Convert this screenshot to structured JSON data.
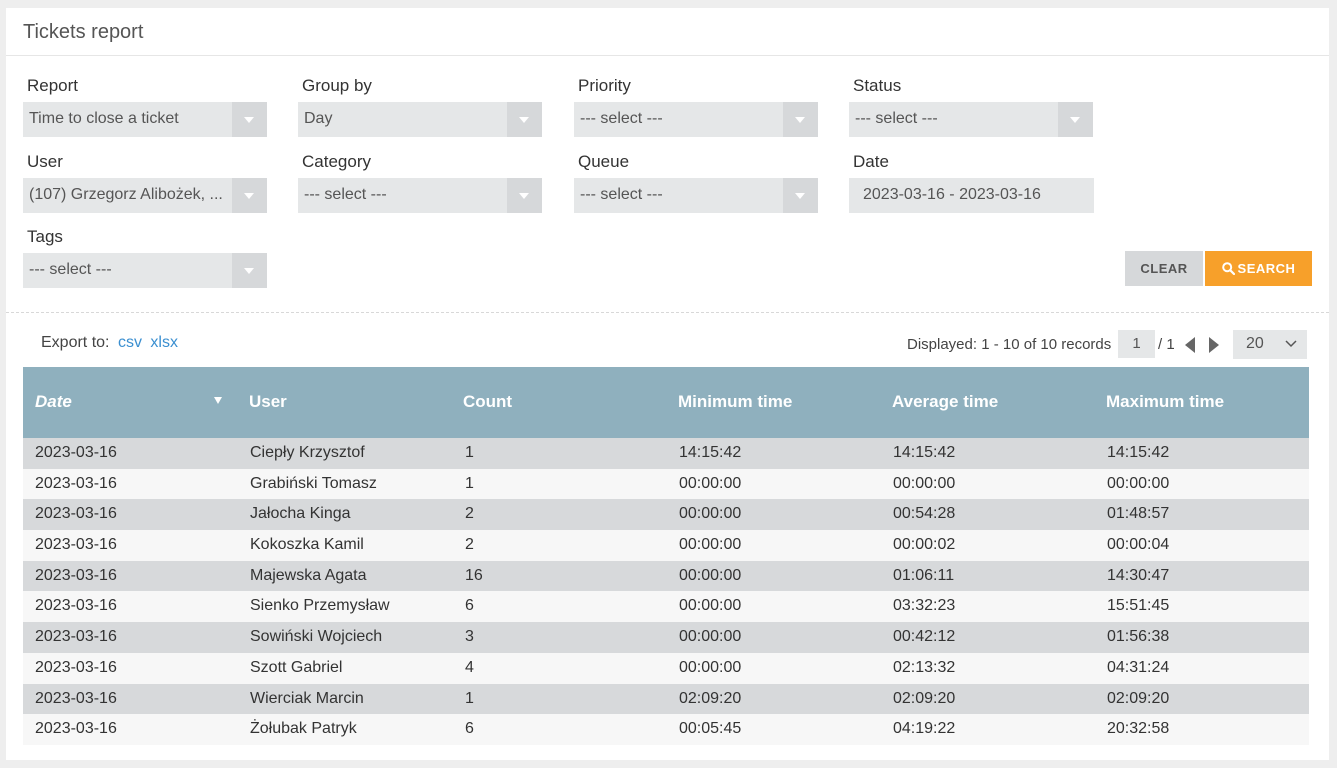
{
  "panel": {
    "title": "Tickets report"
  },
  "filters": {
    "report": {
      "label": "Report",
      "value": "Time to close a ticket"
    },
    "group_by": {
      "label": "Group by",
      "value": "Day"
    },
    "priority": {
      "label": "Priority",
      "value": "--- select ---"
    },
    "status": {
      "label": "Status",
      "value": "--- select ---"
    },
    "user": {
      "label": "User",
      "value": "(107) Grzegorz Alibożek, ..."
    },
    "category": {
      "label": "Category",
      "value": "--- select ---"
    },
    "queue": {
      "label": "Queue",
      "value": "--- select ---"
    },
    "date": {
      "label": "Date",
      "value": "2023-03-16 - 2023-03-16"
    },
    "tags": {
      "label": "Tags",
      "value": "--- select ---"
    }
  },
  "buttons": {
    "clear": "CLEAR",
    "search": "SEARCH"
  },
  "export": {
    "label": "Export to:",
    "csv": "csv",
    "xlsx": "xlsx"
  },
  "pager": {
    "displayed": "Displayed: 1 - 10 of 10 records",
    "current_page": "1",
    "total_pages": "/ 1",
    "per_page": "20"
  },
  "table": {
    "columns": [
      "Date",
      "User",
      "Count",
      "Minimum time",
      "Average time",
      "Maximum time"
    ],
    "rows": [
      [
        "2023-03-16",
        "Ciepły Krzysztof",
        "1",
        "14:15:42",
        "14:15:42",
        "14:15:42"
      ],
      [
        "2023-03-16",
        "Grabiński Tomasz",
        "1",
        "00:00:00",
        "00:00:00",
        "00:00:00"
      ],
      [
        "2023-03-16",
        "Jałocha Kinga",
        "2",
        "00:00:00",
        "00:54:28",
        "01:48:57"
      ],
      [
        "2023-03-16",
        "Kokoszka Kamil",
        "2",
        "00:00:00",
        "00:00:02",
        "00:00:04"
      ],
      [
        "2023-03-16",
        "Majewska Agata",
        "16",
        "00:00:00",
        "01:06:11",
        "14:30:47"
      ],
      [
        "2023-03-16",
        "Sienko Przemysław",
        "6",
        "00:00:00",
        "03:32:23",
        "15:51:45"
      ],
      [
        "2023-03-16",
        "Sowiński Wojciech",
        "3",
        "00:00:00",
        "00:42:12",
        "01:56:38"
      ],
      [
        "2023-03-16",
        "Szott Gabriel",
        "4",
        "00:00:00",
        "02:13:32",
        "04:31:24"
      ],
      [
        "2023-03-16",
        "Wierciak Marcin",
        "1",
        "02:09:20",
        "02:09:20",
        "02:09:20"
      ],
      [
        "2023-03-16",
        "Żołubak Patryk",
        "6",
        "00:05:45",
        "04:19:22",
        "20:32:58"
      ]
    ]
  },
  "colors": {
    "accent": "#f7a02a",
    "header_bg": "#8fb0be",
    "link": "#3b8fd0"
  }
}
